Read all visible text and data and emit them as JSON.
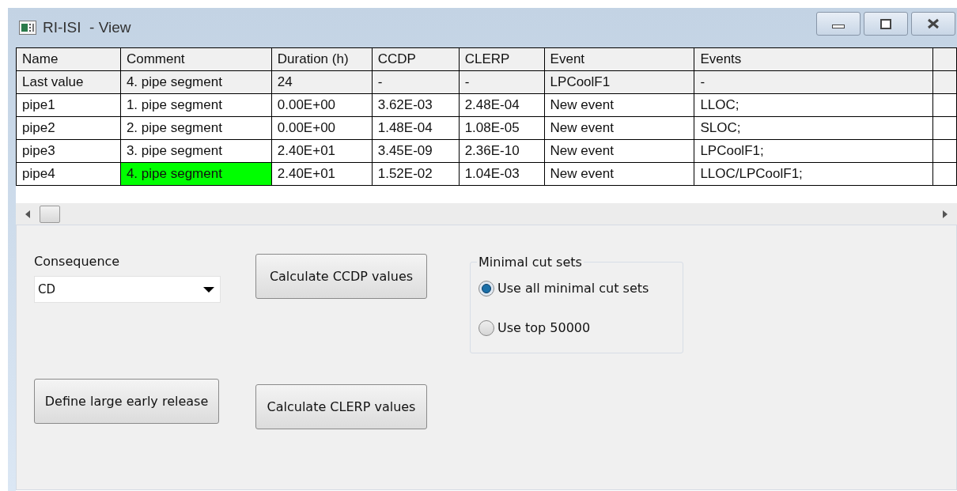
{
  "window": {
    "title": "RI-ISI  - View"
  },
  "table": {
    "columns": [
      "Name",
      "Comment",
      "Duration (h)",
      "CCDP",
      "CLERP",
      "Event",
      "Events"
    ],
    "rows": [
      {
        "kind": "summary",
        "cells": [
          "Last value",
          "4. pipe segment",
          "24",
          "-",
          "-",
          "LPCoolF1",
          "-"
        ]
      },
      {
        "kind": "data",
        "cells": [
          "pipe1",
          "1. pipe segment",
          "0.00E+00",
          "3.62E-03",
          "2.48E-04",
          "New event",
          "LLOC;"
        ]
      },
      {
        "kind": "data",
        "cells": [
          "pipe2",
          "2. pipe segment",
          "0.00E+00",
          "1.48E-04",
          "1.08E-05",
          "New event",
          "SLOC;"
        ]
      },
      {
        "kind": "data",
        "cells": [
          "pipe3",
          "3. pipe segment",
          "2.40E+01",
          "3.45E-09",
          "2.36E-10",
          "New event",
          "LPCoolF1;"
        ]
      },
      {
        "kind": "data",
        "cells": [
          "pipe4",
          {
            "text": "4. pipe segment",
            "color": "#00ff00"
          },
          "2.40E+01",
          "1.52E-02",
          "1.04E-03",
          "New event",
          "LLOC/LPCoolF1;"
        ]
      }
    ]
  },
  "consequence": {
    "label": "Consequence",
    "value": "CD"
  },
  "buttons": [
    "Calculate CCDP values",
    "Define large early release",
    "Calculate CLERP values"
  ],
  "cut_sets": {
    "title": "Minimal cut sets",
    "options": [
      {
        "label": "Use all minimal cut sets",
        "selected": true
      },
      {
        "label": "Use top 50000",
        "selected": false
      }
    ]
  }
}
